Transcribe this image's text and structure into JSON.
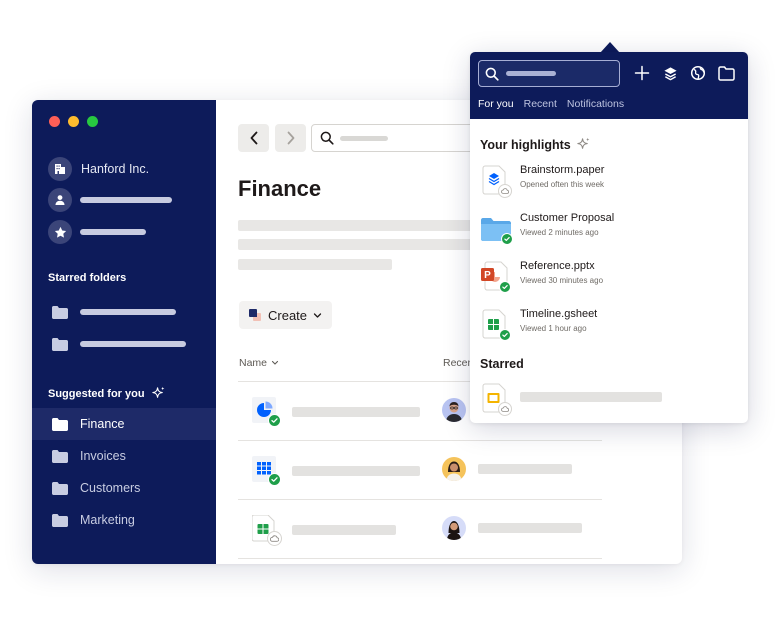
{
  "window": {
    "traffic_lights": [
      "close",
      "minimize",
      "maximize"
    ]
  },
  "sidebar": {
    "team_name": "Hanford Inc.",
    "team_icon": "building-icon",
    "account_items": [
      {
        "icon": "building-icon",
        "label": "Hanford Inc."
      },
      {
        "icon": "person-icon",
        "label": ""
      },
      {
        "icon": "star-icon",
        "label": ""
      }
    ],
    "starred_heading": "Starred folders",
    "starred_folders": [
      {
        "icon": "folder-icon",
        "label": ""
      },
      {
        "icon": "folder-icon",
        "label": ""
      }
    ],
    "suggested_heading": "Suggested for you",
    "suggested_folders": [
      {
        "icon": "folder-icon",
        "label": "Finance",
        "active": true
      },
      {
        "icon": "folder-icon",
        "label": "Invoices",
        "active": false
      },
      {
        "icon": "folder-icon",
        "label": "Customers",
        "active": false
      },
      {
        "icon": "folder-icon",
        "label": "Marketing",
        "active": false
      }
    ]
  },
  "content": {
    "nav": {
      "back_icon": "chevron-left-icon",
      "forward_icon": "chevron-right-icon",
      "search_icon": "search-icon"
    },
    "page_title": "Finance",
    "create_button": "Create",
    "columns": {
      "name": "Name",
      "recent": "Recen"
    },
    "files": [
      {
        "type": "pie-chart-file",
        "status": "synced",
        "avatar": "person-man-glasses"
      },
      {
        "type": "grid-file",
        "status": "synced",
        "avatar": "person-woman"
      },
      {
        "type": "gsheet-file",
        "status": "cloud",
        "avatar": "person-woman-dark"
      }
    ]
  },
  "popover": {
    "tabs": [
      {
        "label": "For you",
        "active": true
      },
      {
        "label": "Recent",
        "active": false
      },
      {
        "label": "Notifications",
        "active": false
      }
    ],
    "header_icons": [
      "plus-icon",
      "layers-icon",
      "globe-icon",
      "folder-icon"
    ],
    "highlights_title": "Your highlights",
    "highlights": [
      {
        "name": "Brainstorm.paper",
        "subtitle": "Opened often this week",
        "type": "paper",
        "status": "cloud"
      },
      {
        "name": "Customer Proposal",
        "subtitle": "Viewed 2 minutes ago",
        "type": "folder",
        "status": "synced"
      },
      {
        "name": "Reference.pptx",
        "subtitle": "Viewed 30 minutes ago",
        "type": "pptx",
        "status": "synced"
      },
      {
        "name": "Timeline.gsheet",
        "subtitle": "Viewed 1 hour ago",
        "type": "gsheet",
        "status": "synced"
      }
    ],
    "starred_title": "Starred",
    "starred": [
      {
        "type": "gslides",
        "status": "cloud"
      }
    ]
  },
  "colors": {
    "sidebar_bg": "#0d1b5a",
    "accent_blue": "#0061fe",
    "sync_green": "#1f9f4a",
    "traffic_red": "#fe5f57",
    "traffic_yellow": "#febc2e",
    "traffic_green": "#28c840"
  }
}
